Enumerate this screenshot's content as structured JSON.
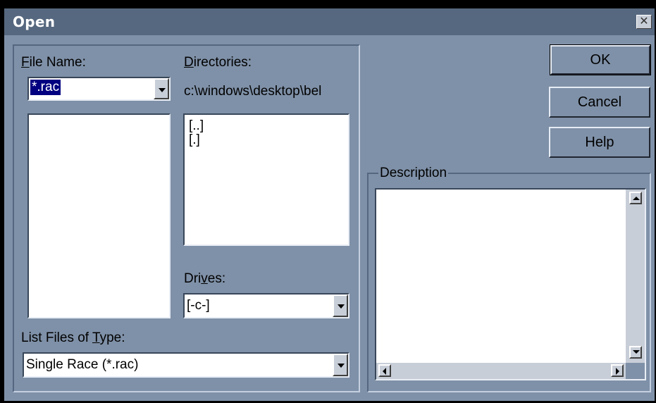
{
  "dialog": {
    "title": "Open",
    "close_glyph": "✕"
  },
  "file_name": {
    "label_prefix": "",
    "label_accel": "F",
    "label_rest": "ile Name:",
    "value": "*.rac"
  },
  "directories": {
    "label_accel": "D",
    "label_rest": "irectories:",
    "path": "c:\\windows\\desktop\\bel",
    "items": [
      "[..]",
      "[.]"
    ]
  },
  "drives": {
    "label_prefix": "Dri",
    "label_accel": "v",
    "label_rest": "es:",
    "value": "[-c-]"
  },
  "file_type": {
    "label_prefix": "List Files of ",
    "label_accel": "T",
    "label_rest": "ype:",
    "value": "Single Race (*.rac)"
  },
  "buttons": {
    "ok": "OK",
    "cancel": "Cancel",
    "help": "Help"
  },
  "description": {
    "label": "Description"
  },
  "icons": [
    "close-icon",
    "dropdown-arrow-icon",
    "scroll-up-icon",
    "scroll-down-icon",
    "scroll-left-icon",
    "scroll-right-icon"
  ]
}
